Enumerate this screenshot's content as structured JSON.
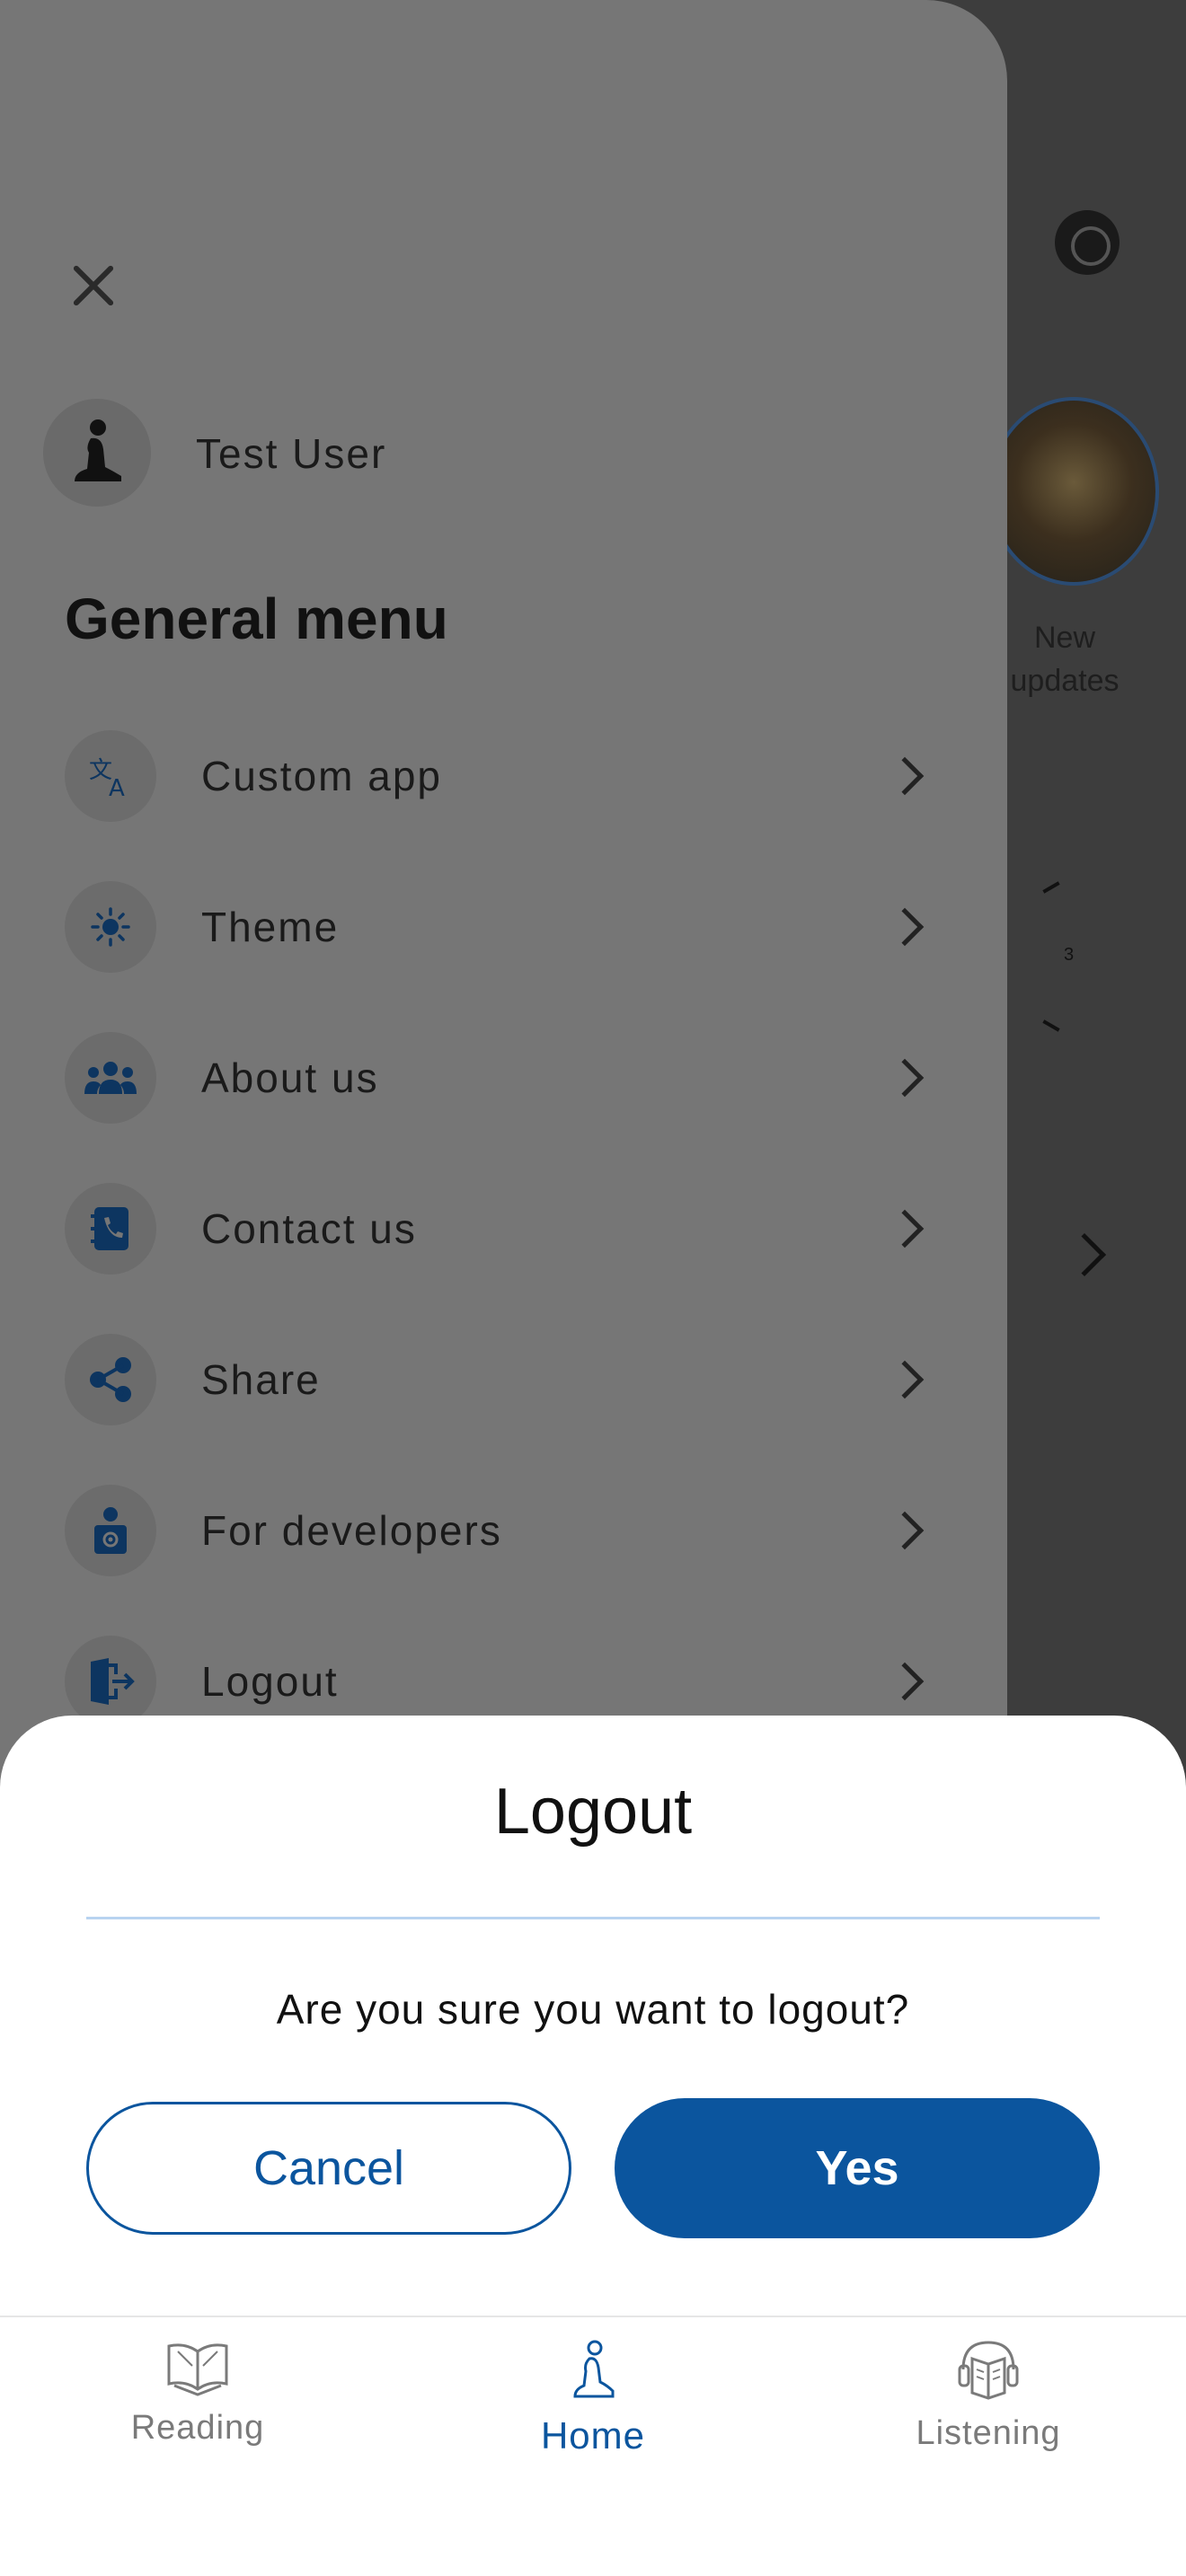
{
  "background": {
    "story_label_line1": "New",
    "story_label_line2": "updates",
    "clock_number": "3"
  },
  "drawer": {
    "user_name": "Test User",
    "menu_title": "General menu",
    "items": [
      {
        "label": "Custom app",
        "icon": "translate-icon"
      },
      {
        "label": "Theme",
        "icon": "sun-icon"
      },
      {
        "label": "About us",
        "icon": "group-icon"
      },
      {
        "label": "Contact us",
        "icon": "phone-book-icon"
      },
      {
        "label": "Share",
        "icon": "share-icon"
      },
      {
        "label": "For developers",
        "icon": "developer-icon"
      },
      {
        "label": "Logout",
        "icon": "logout-icon"
      }
    ]
  },
  "dialog": {
    "title": "Logout",
    "message": "Are you sure you want to logout?",
    "cancel_label": "Cancel",
    "confirm_label": "Yes"
  },
  "bottom_nav": {
    "items": [
      {
        "label": "Reading",
        "icon": "open-book-icon",
        "active": false
      },
      {
        "label": "Home",
        "icon": "prayer-icon",
        "active": true
      },
      {
        "label": "Listening",
        "icon": "audio-book-icon",
        "active": false
      }
    ]
  },
  "colors": {
    "accent": "#0b559e",
    "icon_dark": "#0d3560",
    "drawer_bg": "#767676"
  }
}
